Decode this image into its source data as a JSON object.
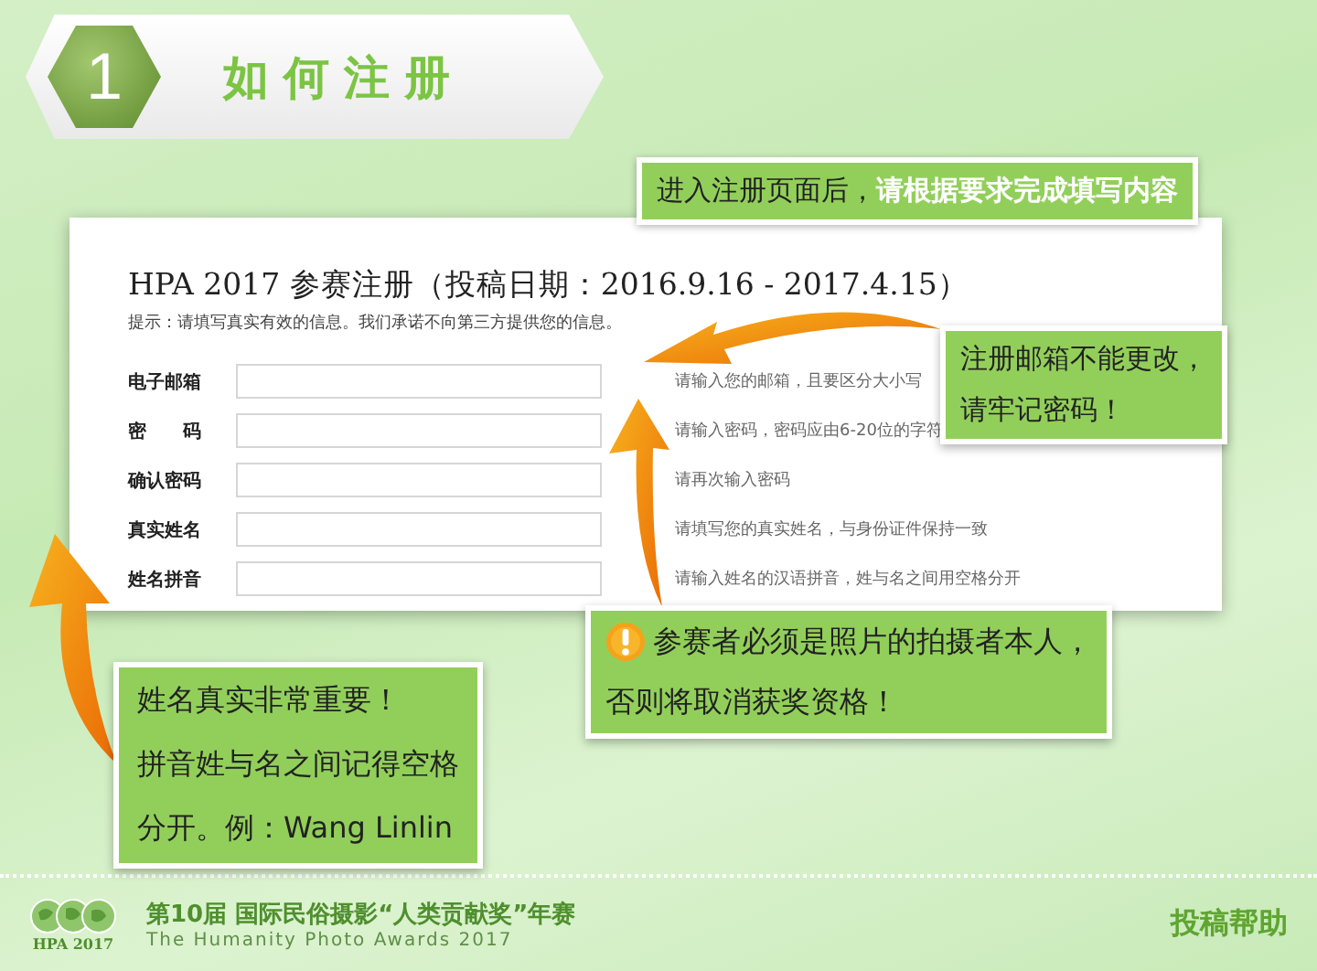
{
  "header": {
    "step": "1",
    "title": "如何注册"
  },
  "intro_callout": "进入注册页面后，**请根据要求完成填写内容**",
  "form": {
    "title": "HPA 2017 参赛注册（投稿日期：2016.9.16 - 2017.4.15）",
    "notice": "提示：请填写真实有效的信息。我们承诺不向第三方提供您的信息。",
    "rows": [
      {
        "label": "电子邮箱",
        "hint": "请输入您的邮箱，且要区分大小写"
      },
      {
        "label": "密　　码",
        "hint": "请输入密码，密码应由6-20位的字符"
      },
      {
        "label": "确认密码",
        "hint": "请再次输入密码"
      },
      {
        "label": "真实姓名",
        "hint": "请填写您的真实姓名，与身份证件保持一致"
      },
      {
        "label": "姓名拼音",
        "hint": "请输入姓名的汉语拼音，姓与名之间用空格分开"
      }
    ]
  },
  "email_callout": [
    "注册邮箱不能更改，",
    "请牢记密码！"
  ],
  "warning_callout": [
    "参赛者必须是照片的拍摄者本人，",
    "否则将取消获奖资格！"
  ],
  "name_callout": [
    "姓名真实非常重要！",
    "拼音姓与名之间记得空格",
    "分开。例：Wang Linlin"
  ],
  "footer": {
    "logo_text": "HPA 2017",
    "title": "第10届 国际民俗摄影“人类贡献奖”年赛",
    "subtitle": "The Humanity Photo Awards 2017",
    "section": "投稿帮助"
  }
}
